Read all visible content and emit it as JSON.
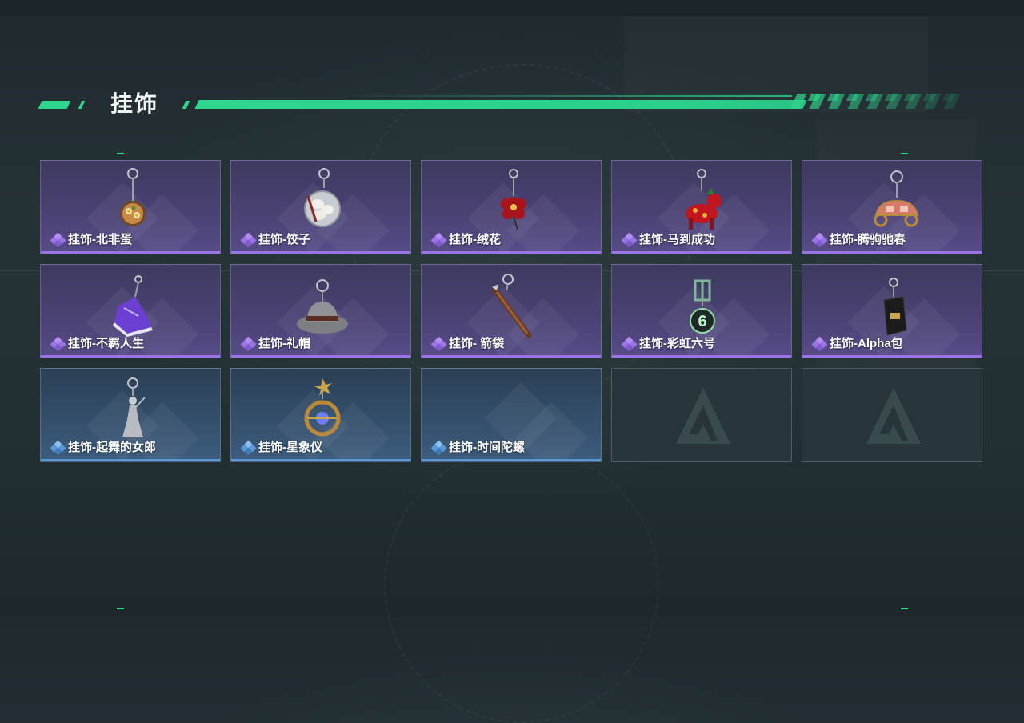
{
  "section": {
    "title": "挂饰"
  },
  "colors": {
    "accent": "#2fd68e",
    "purple_rarity": "#9a74e6",
    "blue_rarity": "#5d99d6"
  },
  "items": [
    {
      "label": "挂饰-北非蛋",
      "rarity": "purple",
      "icon": "food-plate-charm-icon"
    },
    {
      "label": "挂饰-饺子",
      "rarity": "purple",
      "icon": "dumpling-charm-icon"
    },
    {
      "label": "挂饰-绒花",
      "rarity": "purple",
      "icon": "velvet-flower-charm-icon"
    },
    {
      "label": "挂饰-马到成功",
      "rarity": "purple",
      "icon": "red-horse-charm-icon"
    },
    {
      "label": "挂饰-腾驹驰春",
      "rarity": "purple",
      "icon": "carriage-charm-icon"
    },
    {
      "label": "挂饰-不羁人生",
      "rarity": "purple",
      "icon": "sneaker-charm-icon"
    },
    {
      "label": "挂饰-礼帽",
      "rarity": "purple",
      "icon": "hat-charm-icon"
    },
    {
      "label": "挂饰- 箭袋",
      "rarity": "purple",
      "icon": "quiver-charm-icon"
    },
    {
      "label": "挂饰-彩虹六号",
      "rarity": "purple",
      "icon": "rainbow-six-charm-icon"
    },
    {
      "label": "挂饰-Alpha包",
      "rarity": "purple",
      "icon": "alpha-bag-charm-icon"
    },
    {
      "label": "挂饰-起舞的女郎",
      "rarity": "blue",
      "icon": "dancer-charm-icon"
    },
    {
      "label": "挂饰-星象仪",
      "rarity": "blue",
      "icon": "astrolabe-charm-icon"
    },
    {
      "label": "挂饰-时间陀螺",
      "rarity": "blue",
      "icon": ""
    },
    {
      "label": "",
      "rarity": "empty",
      "icon": "empty-slot-logo-icon"
    },
    {
      "label": "",
      "rarity": "empty",
      "icon": "empty-slot-logo-icon"
    }
  ]
}
